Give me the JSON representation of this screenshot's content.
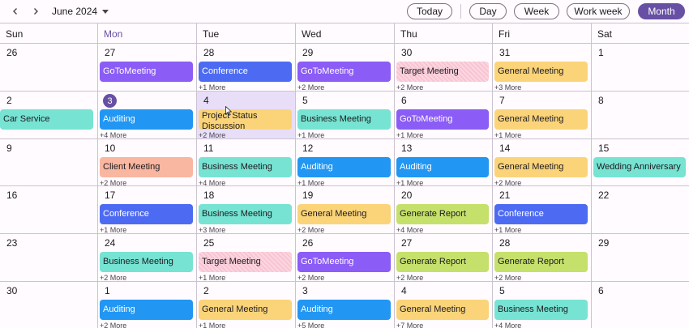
{
  "toolbar": {
    "month_label": "June 2024",
    "views": [
      "Today",
      "Day",
      "Week",
      "Work week",
      "Month"
    ],
    "active_view": "Month"
  },
  "days_of_week": [
    "Sun",
    "Mon",
    "Tue",
    "Wed",
    "Thu",
    "Fri",
    "Sat"
  ],
  "today_dow_index": 1,
  "colors": {
    "accent": "#6750a4",
    "purple": "#8b5cf6",
    "blue": "#2196f3",
    "indigo": "#4d6bf2",
    "pink": "#f8c4d3",
    "yellow": "#fbd47a",
    "teal": "#77e3d3",
    "salmon": "#f9b6a0",
    "lime": "#c6e06c"
  },
  "weeks": [
    [
      {
        "date": "26"
      },
      {
        "date": "27",
        "appt": "GoToMeeting",
        "color": "purple"
      },
      {
        "date": "28",
        "appt": "Conference",
        "color": "indigo",
        "more": "+1 More"
      },
      {
        "date": "29",
        "appt": "GoToMeeting",
        "color": "purple",
        "more": "+2 More"
      },
      {
        "date": "30",
        "appt": "Target Meeting",
        "color": "pink",
        "more": "+2 More"
      },
      {
        "date": "31",
        "appt": "General Meeting",
        "color": "yellow",
        "more": "+3 More"
      },
      {
        "date": "1"
      }
    ],
    [
      {
        "date": "2",
        "appt": "Car Service",
        "color": "teal"
      },
      {
        "date": "3",
        "today": true,
        "appt": "Auditing",
        "color": "blue",
        "more": "+4 More"
      },
      {
        "date": "4",
        "selected": true,
        "appt": "Project Status Discussion",
        "color": "yellow",
        "tall": true,
        "more": "+2 More"
      },
      {
        "date": "5",
        "appt": "Business Meeting",
        "color": "teal",
        "more": "+1 More"
      },
      {
        "date": "6",
        "appt": "GoToMeeting",
        "color": "purple",
        "more": "+1 More"
      },
      {
        "date": "7",
        "appt": "General Meeting",
        "color": "yellow",
        "more": "+1 More"
      },
      {
        "date": "8"
      }
    ],
    [
      {
        "date": "9"
      },
      {
        "date": "10",
        "appt": "Client Meeting",
        "color": "salmon",
        "more": "+2 More"
      },
      {
        "date": "11",
        "appt": "Business Meeting",
        "color": "teal",
        "more": "+4 More"
      },
      {
        "date": "12",
        "appt": "Auditing",
        "color": "blue",
        "more": "+1 More"
      },
      {
        "date": "13",
        "appt": "Auditing",
        "color": "blue",
        "more": "+1 More"
      },
      {
        "date": "14",
        "appt": "General Meeting",
        "color": "yellow",
        "more": "+2 More"
      },
      {
        "date": "15",
        "appt": "Wedding Anniversary",
        "color": "teal"
      }
    ],
    [
      {
        "date": "16"
      },
      {
        "date": "17",
        "appt": "Conference",
        "color": "indigo",
        "more": "+1 More"
      },
      {
        "date": "18",
        "appt": "Business Meeting",
        "color": "teal",
        "more": "+3 More"
      },
      {
        "date": "19",
        "appt": "General Meeting",
        "color": "yellow",
        "more": "+2 More"
      },
      {
        "date": "20",
        "appt": "Generate Report",
        "color": "lime",
        "more": "+4 More"
      },
      {
        "date": "21",
        "appt": "Conference",
        "color": "indigo",
        "more": "+1 More"
      },
      {
        "date": "22"
      }
    ],
    [
      {
        "date": "23"
      },
      {
        "date": "24",
        "appt": "Business Meeting",
        "color": "teal",
        "more": "+2 More"
      },
      {
        "date": "25",
        "appt": "Target Meeting",
        "color": "pink",
        "more": "+1 More"
      },
      {
        "date": "26",
        "appt": "GoToMeeting",
        "color": "purple",
        "more": "+2 More"
      },
      {
        "date": "27",
        "appt": "Generate Report",
        "color": "lime",
        "more": "+2 More"
      },
      {
        "date": "28",
        "appt": "Generate Report",
        "color": "lime",
        "more": "+2 More"
      },
      {
        "date": "29"
      }
    ],
    [
      {
        "date": "30"
      },
      {
        "date": "1",
        "appt": "Auditing",
        "color": "blue",
        "more": "+2 More"
      },
      {
        "date": "2",
        "appt": "General Meeting",
        "color": "yellow",
        "more": "+1 More"
      },
      {
        "date": "3",
        "appt": "Auditing",
        "color": "blue",
        "more": "+5 More"
      },
      {
        "date": "4",
        "appt": "General Meeting",
        "color": "yellow",
        "more": "+7 More"
      },
      {
        "date": "5",
        "appt": "Business Meeting",
        "color": "teal",
        "more": "+4 More"
      },
      {
        "date": "6"
      }
    ]
  ]
}
